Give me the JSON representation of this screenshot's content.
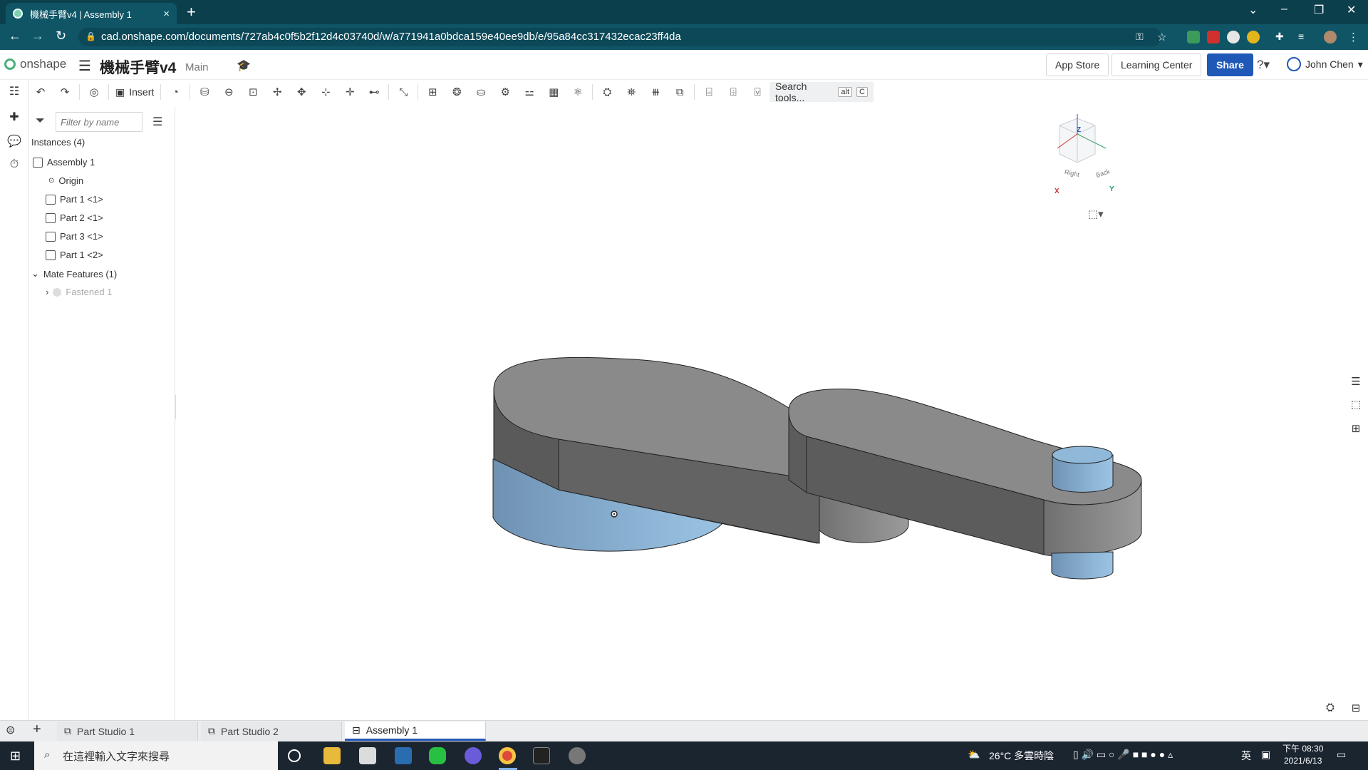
{
  "browser": {
    "tab_title": "機械手臂v4 | Assembly 1",
    "tab_close": "×",
    "new_tab": "+",
    "url": "cad.onshape.com/documents/727ab4c0f5b2f12d4c03740d/w/a771941a0bdca159e40ee9db/e/95a84cc317432ecac23ff4da"
  },
  "header": {
    "logo": "onshape",
    "doc_title": "機械手臂v4",
    "branch": "Main",
    "app_store": "App Store",
    "learning_center": "Learning Center",
    "share": "Share",
    "user": "John Chen"
  },
  "toolbar": {
    "insert": "Insert",
    "search_tools": "Search tools...",
    "kbd_alt": "alt",
    "kbd_c": "C"
  },
  "panel": {
    "filter_placeholder": "Filter by name",
    "instances_heading": "Instances (4)",
    "items": [
      {
        "label": "Assembly 1"
      },
      {
        "label": "Origin"
      },
      {
        "label": "Part 1 <1>"
      },
      {
        "label": "Part 2 <1>"
      },
      {
        "label": "Part 3 <1>"
      },
      {
        "label": "Part 1 <2>"
      }
    ],
    "mates_heading": "Mate Features (1)",
    "mate": "Fastened 1"
  },
  "viewcube": {
    "z": "Z",
    "x": "X",
    "y": "Y",
    "right": "Right",
    "back": "Back"
  },
  "doc_tabs": [
    {
      "label": "Part Studio 1"
    },
    {
      "label": "Part Studio 2"
    },
    {
      "label": "Assembly 1"
    }
  ],
  "taskbar": {
    "search_placeholder": "在這裡輸入文字來搜尋",
    "weather": "26°C  多雲時陰",
    "ime": "英",
    "time": "下午 08:30",
    "date": "2021/6/13"
  },
  "colors": {
    "brand_blue": "#2058b8",
    "chrome_teal": "#0f5566",
    "part_gray": "#8c8c8c",
    "pin_blue": "#8ab0cf"
  }
}
